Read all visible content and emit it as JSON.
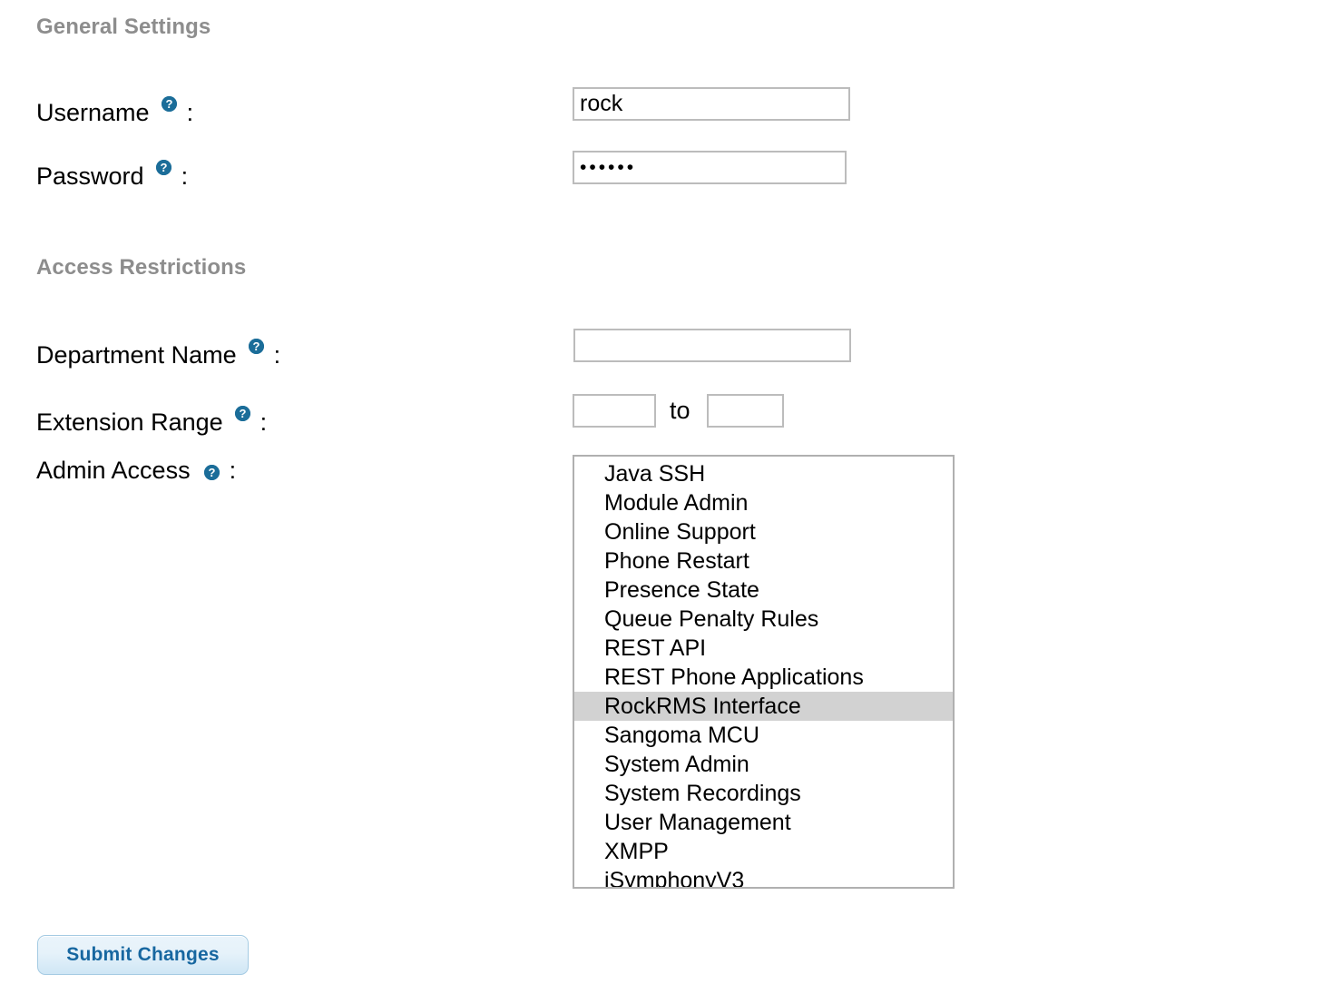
{
  "sections": {
    "general": {
      "heading": "General Settings",
      "fields": {
        "username": {
          "label": "Username",
          "colon": ":",
          "value": "rock",
          "placeholder": "",
          "help_icon": "help-circle-icon"
        },
        "password": {
          "label": "Password",
          "colon": ":",
          "value": "••••••",
          "placeholder": "",
          "help_icon": "help-circle-icon"
        }
      }
    },
    "access": {
      "heading": "Access Restrictions",
      "fields": {
        "department_name": {
          "label": "Department Name",
          "colon": ":",
          "value": "",
          "placeholder": "",
          "help_icon": "help-circle-icon"
        },
        "extension_range": {
          "label": "Extension Range",
          "colon": ":",
          "separator": "to",
          "start_value": "",
          "end_value": "",
          "start_placeholder": "",
          "end_placeholder": "",
          "help_icon": "help-circle-icon"
        },
        "admin_access": {
          "label": "Admin Access",
          "colon": ":",
          "help_icon": "help-circle-icon",
          "options": [
            {
              "label": "Java SSH",
              "selected": false
            },
            {
              "label": "Module Admin",
              "selected": false
            },
            {
              "label": "Online Support",
              "selected": false
            },
            {
              "label": "Phone Restart",
              "selected": false
            },
            {
              "label": "Presence State",
              "selected": false
            },
            {
              "label": "Queue Penalty Rules",
              "selected": false
            },
            {
              "label": "REST API",
              "selected": false
            },
            {
              "label": "REST Phone Applications",
              "selected": false
            },
            {
              "label": "RockRMS Interface",
              "selected": true
            },
            {
              "label": "Sangoma MCU",
              "selected": false
            },
            {
              "label": "System Admin",
              "selected": false
            },
            {
              "label": "System Recordings",
              "selected": false
            },
            {
              "label": "User Management",
              "selected": false
            },
            {
              "label": "XMPP",
              "selected": false
            },
            {
              "label": "iSymphonyV3",
              "selected": false
            }
          ]
        }
      }
    }
  },
  "actions": {
    "submit_label": "Submit Changes"
  },
  "colors": {
    "heading": "#8d8d8d",
    "help_icon": "#1b6d99",
    "input_border": "#bcbcbc",
    "list_border": "#b0b0b0",
    "selected_row": "#d2d2d2",
    "button_text": "#1767a0",
    "button_border": "#a5cbe3"
  }
}
